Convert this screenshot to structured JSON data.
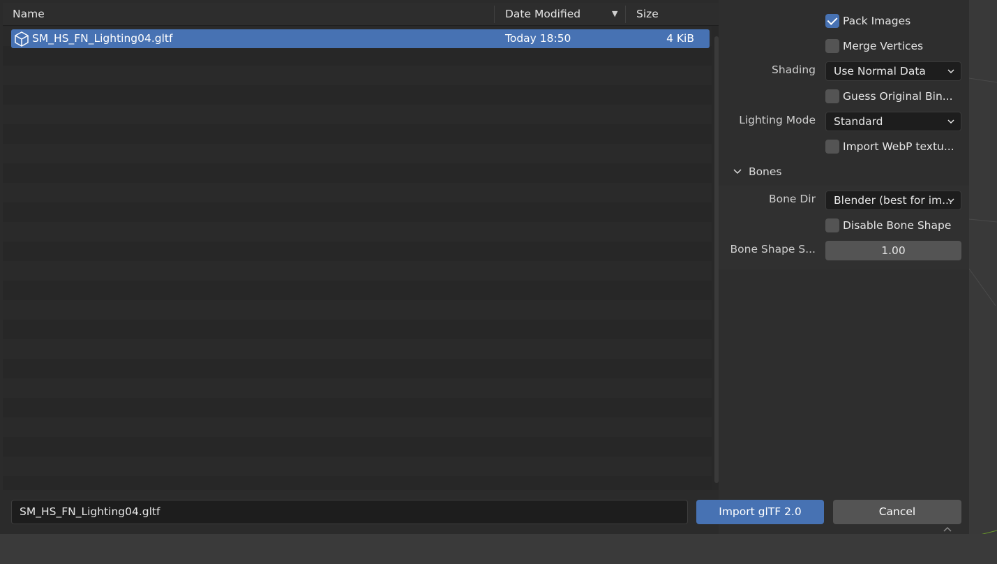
{
  "file_list": {
    "columns": {
      "name": "Name",
      "date": "Date Modified",
      "size": "Size"
    },
    "sort_indicator": "▼",
    "files": [
      {
        "name": "SM_HS_FN_Lighting04.gltf",
        "date": "Today 18:50",
        "size": "4 KiB",
        "icon": "cube-icon",
        "selected": true
      }
    ]
  },
  "options": {
    "pack_images": {
      "label": "Pack Images",
      "checked": true
    },
    "merge_vertices": {
      "label": "Merge Vertices",
      "checked": false
    },
    "shading": {
      "label": "Shading",
      "value": "Use Normal Data"
    },
    "guess_original_bind": {
      "label": "Guess Original Bin...",
      "checked": false
    },
    "lighting_mode": {
      "label": "Lighting Mode",
      "value": "Standard"
    },
    "import_webp": {
      "label": "Import WebP textu...",
      "checked": false
    },
    "bones_section": {
      "label": "Bones",
      "expanded": true
    },
    "bone_dir": {
      "label": "Bone Dir",
      "value": "Blender (best for im..."
    },
    "disable_bone_shape": {
      "label": "Disable Bone Shape",
      "checked": false
    },
    "bone_shape_scale": {
      "label": "Bone Shape S...",
      "value": "1.00"
    }
  },
  "footer": {
    "filename_value": "SM_HS_FN_Lighting04.gltf",
    "import_label": "Import glTF 2.0",
    "cancel_label": "Cancel"
  },
  "colors": {
    "accent": "#4772b3",
    "panel": "#2e2e2e",
    "field": "#1d1d1d",
    "button": "#545454"
  }
}
